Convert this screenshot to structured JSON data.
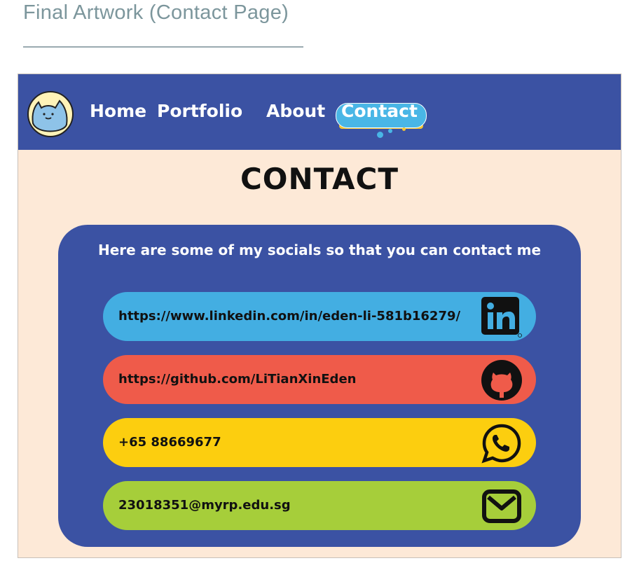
{
  "caption": "Final Artwork (Contact Page)",
  "nav": {
    "home": "Home",
    "portfolio": "Portfolio",
    "about": "About",
    "contact": "Contact"
  },
  "page_title": "CONTACT",
  "card": {
    "heading": "Here are some of my socials so that you can contact me",
    "links": [
      {
        "text": "https://www.linkedin.com/in/eden-li-581b16279/",
        "icon": "linkedin-icon",
        "color": "#43aee2"
      },
      {
        "text": "https://github.com/LiTianXinEden",
        "icon": "github-icon",
        "color": "#ef5b4a"
      },
      {
        "text": "+65 88669677",
        "icon": "whatsapp-icon",
        "color": "#fcce0f"
      },
      {
        "text": "23018351@myrp.edu.sg",
        "icon": "email-icon",
        "color": "#a6ce3a"
      }
    ]
  },
  "colors": {
    "navbar": "#3b52a3",
    "background": "#fde9d7",
    "accent": "#49b6e6"
  }
}
